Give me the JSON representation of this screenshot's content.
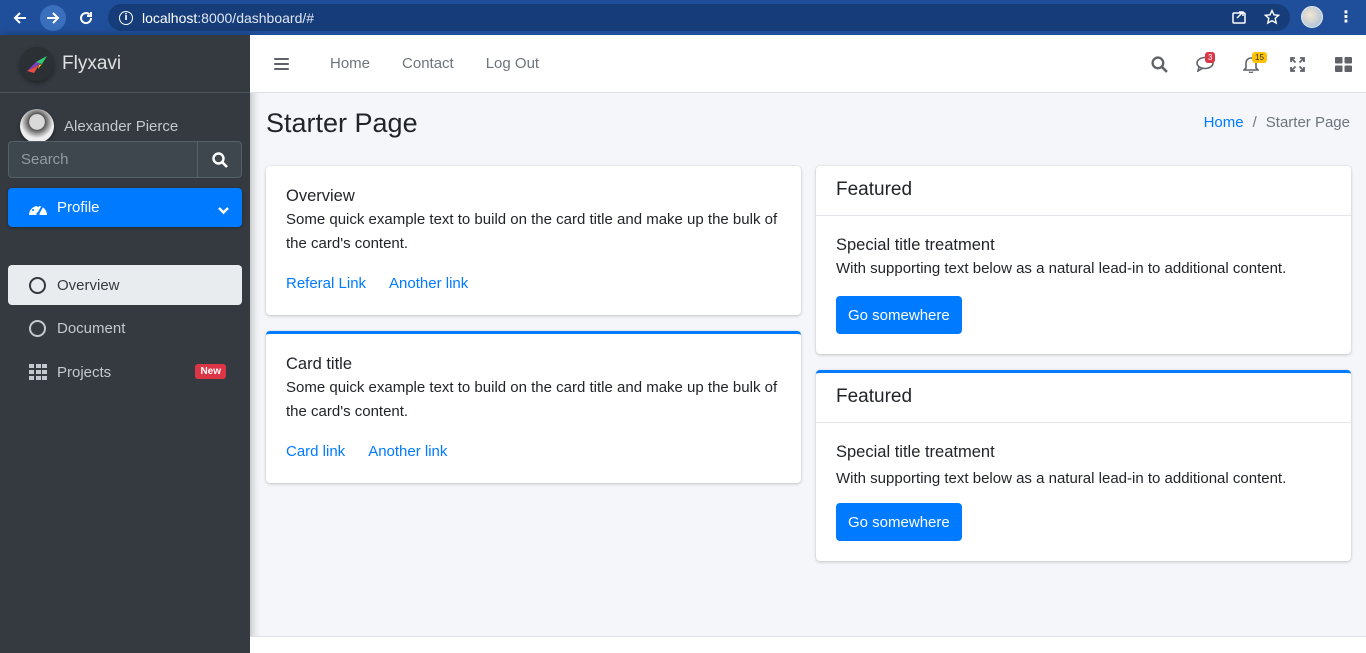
{
  "browser": {
    "url_host": "localhost",
    "url_rest": ":8000/dashboard/#"
  },
  "brand": {
    "name": "Flyxavi"
  },
  "user": {
    "name": "Alexander Pierce"
  },
  "sidebar": {
    "search_placeholder": "Search",
    "menu": {
      "label": "Profile",
      "items": [
        {
          "label": "Overview"
        },
        {
          "label": "Document"
        }
      ]
    },
    "projects": {
      "label": "Projects",
      "badge": "New"
    }
  },
  "topnav": {
    "links": [
      "Home",
      "Contact",
      "Log Out"
    ],
    "messages_count": "3",
    "notifications_count": "15"
  },
  "page": {
    "title": "Starter Page",
    "breadcrumb": {
      "home": "Home",
      "separator": "/",
      "current": "Starter Page"
    }
  },
  "cards_left": [
    {
      "title": "Overview",
      "text": "Some quick example text to build on the card title and make up the bulk of the card's content.",
      "links": [
        "Referal Link",
        "Another link"
      ]
    },
    {
      "title": "Card title",
      "text": "Some quick example text to build on the card title and make up the bulk of the card's content.",
      "links": [
        "Card link",
        "Another link"
      ]
    }
  ],
  "cards_right": [
    {
      "header": "Featured",
      "title": "Special title treatment",
      "text": "With supporting text below as a natural lead-in to additional content.",
      "button": "Go somewhere"
    },
    {
      "header": "Featured",
      "title": "Special title treatment",
      "text": "With supporting text below as a natural lead-in to additional content.",
      "button": "Go somewhere"
    }
  ],
  "colors": {
    "primary": "#007bff",
    "sidebar_bg": "#343a40",
    "badge_danger": "#dc3545",
    "badge_warning": "#ffc107",
    "browser_bar": "#1f4f9a"
  }
}
